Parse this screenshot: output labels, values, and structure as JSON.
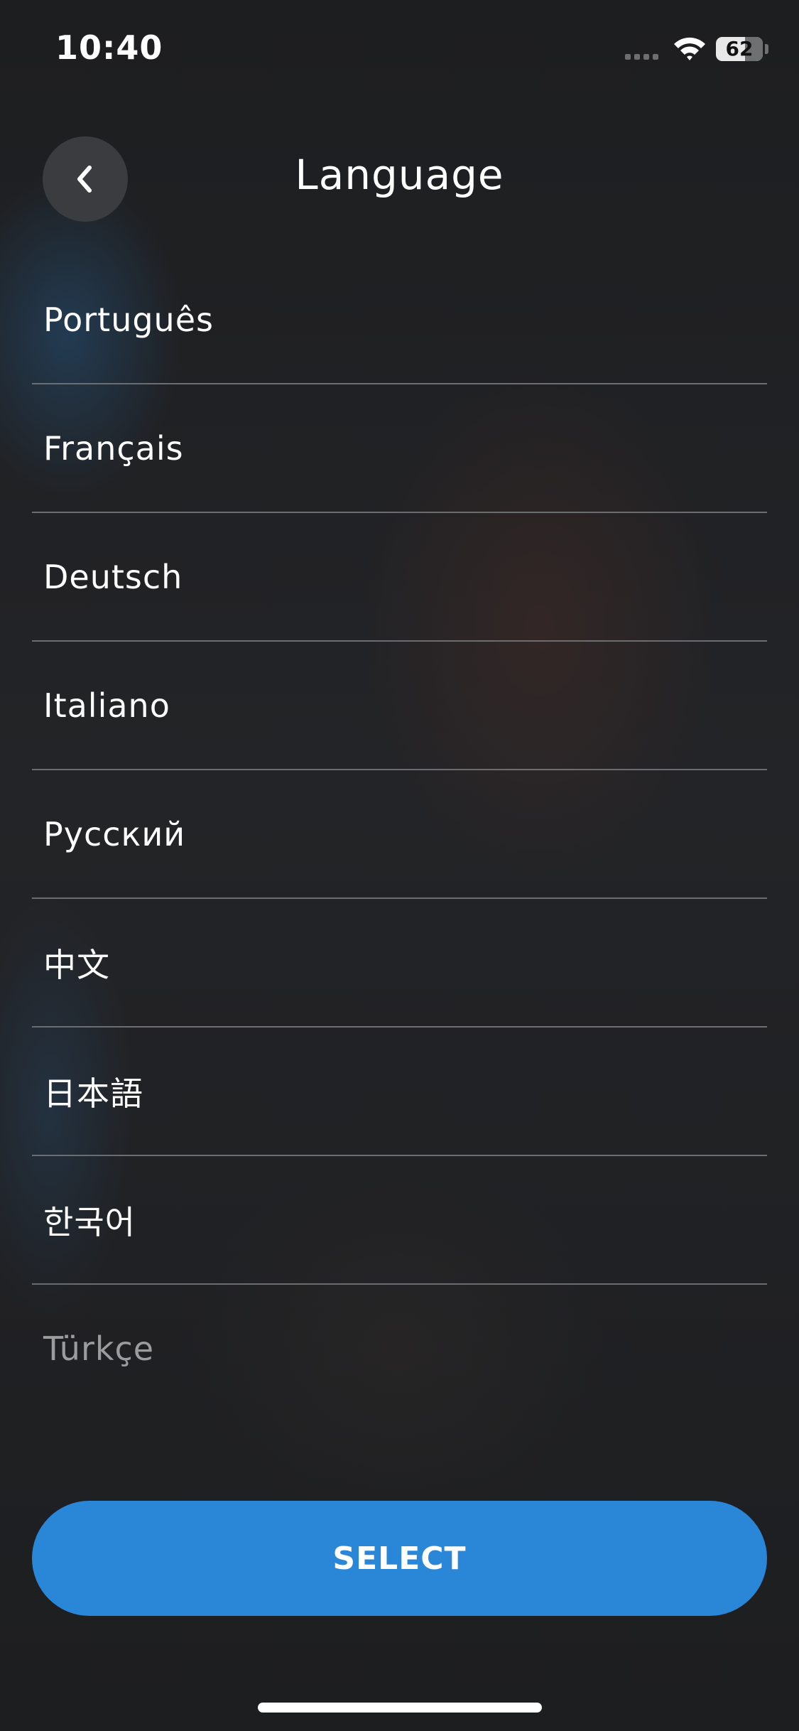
{
  "status_bar": {
    "time": "10:40",
    "battery_level": "62"
  },
  "header": {
    "title": "Language",
    "back_icon": "chevron-left-icon"
  },
  "languages": [
    "Português",
    "Français",
    "Deutsch",
    "Italiano",
    "Русский",
    "中文",
    "日本語",
    "한국어",
    "Türkçe"
  ],
  "select_button": {
    "label": "SELECT",
    "color": "#2a87d8"
  }
}
